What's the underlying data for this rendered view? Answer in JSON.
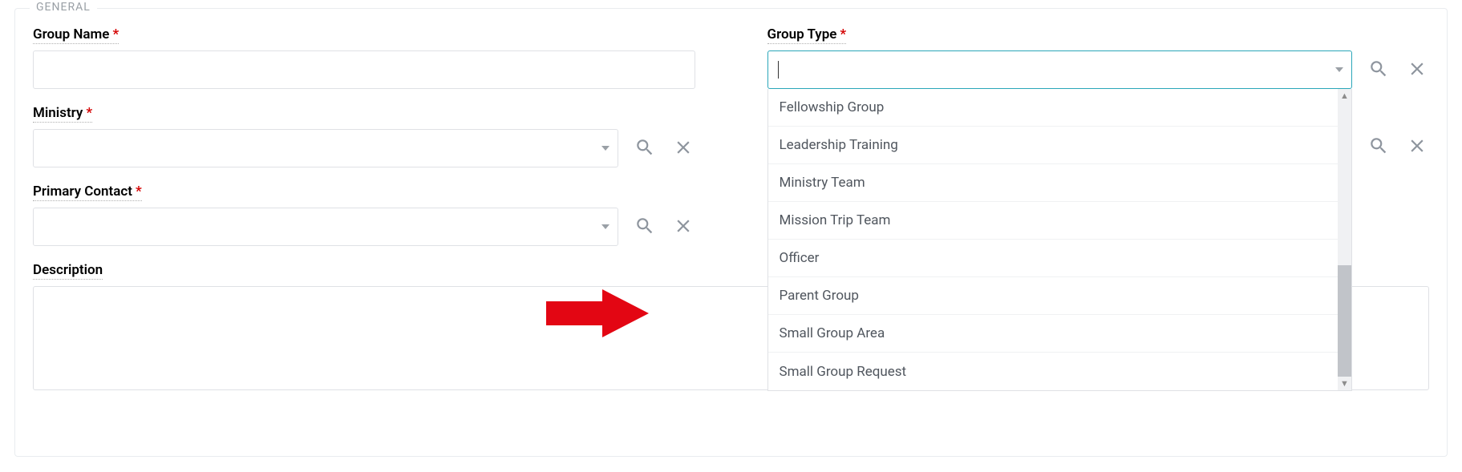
{
  "legend": "GENERAL",
  "fields": {
    "group_name": {
      "label": "Group Name",
      "required": true,
      "value": ""
    },
    "ministry": {
      "label": "Ministry",
      "required": true,
      "value": ""
    },
    "primary_contact": {
      "label": "Primary Contact",
      "required": true,
      "value": ""
    },
    "description": {
      "label": "Description",
      "required": false,
      "value": ""
    },
    "group_type": {
      "label": "Group Type",
      "required": true,
      "value": ""
    },
    "second_right": {
      "value": ""
    }
  },
  "group_type_options": [
    "Fellowship Group",
    "Leadership Training",
    "Ministry Team",
    "Mission Trip Team",
    "Officer",
    "Parent Group",
    "Small Group Area",
    "Small Group Request"
  ],
  "required_marker": "*",
  "annotation": {
    "target_option": "Parent Group",
    "color": "#e30613"
  }
}
